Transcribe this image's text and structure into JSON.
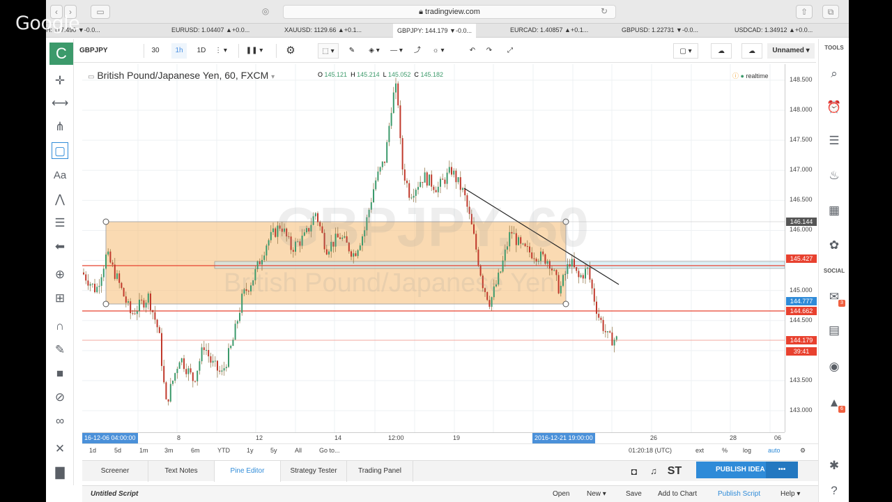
{
  "browser": {
    "url": "tradingview.com",
    "overlay_logo": "Google"
  },
  "ticker": [
    {
      "sym": "H: 117.490 ▼-0.0..."
    },
    {
      "sym": "EURUSD: 1.04407 ▲+0.0..."
    },
    {
      "sym": "XAUUSD: 1129.66 ▲+0.1..."
    },
    {
      "sym": "GBPJPY: 144.179 ▼-0.0..."
    },
    {
      "sym": "EURCAD: 1.40857 ▲+0.1..."
    },
    {
      "sym": "GBPUSD: 1.22731 ▼-0.0..."
    },
    {
      "sym": "USDCAD: 1.34912 ▲+0.0..."
    }
  ],
  "toolbar": {
    "symbol": "GBPJPY",
    "int_30": "30",
    "int_1h": "1h",
    "int_1d": "1D",
    "layout_name": "Unnamed"
  },
  "chart": {
    "title": "British Pound/Japanese Yen, 60, FXCM",
    "o_label": "O",
    "o": "145.121",
    "h_label": "H",
    "h": "145.214",
    "l_label": "L",
    "l": "145.052",
    "c_label": "C",
    "c": "145.182",
    "realtime": "realtime",
    "watermark_symbol": "GBPJPY, 60",
    "watermark_name": "British Pound/Japanese Yen"
  },
  "price_axis": {
    "labels": [
      "148.500",
      "148.000",
      "147.500",
      "147.000",
      "146.500",
      "146.000",
      "145.500",
      "145.000",
      "144.500",
      "143.500",
      "143.000"
    ],
    "tags": [
      {
        "text": "146.144",
        "color": "#555555"
      },
      {
        "text": "145.427",
        "color": "#e8412f"
      },
      {
        "text": "144.777",
        "color": "#2f8bd8"
      },
      {
        "text": "144.662",
        "color": "#e8412f"
      },
      {
        "text": "144.179",
        "color": "#e8412f"
      },
      {
        "text": "39:41",
        "color": "#e8412f"
      }
    ]
  },
  "time_axis": {
    "start_tag": "16-12-06 04:00:00",
    "cursor_tag": "2016-12-21 19:00:00",
    "labels": [
      "8",
      "12",
      "14",
      "12:00",
      "19",
      "26",
      "28",
      "06"
    ]
  },
  "range_bar": {
    "ranges": [
      "1d",
      "5d",
      "1m",
      "3m",
      "6m",
      "YTD",
      "1y",
      "5y",
      "All"
    ],
    "goto": "Go to...",
    "clock": "01:20:18 (UTC)",
    "ext": "ext",
    "pct": "%",
    "log": "log",
    "auto": "auto"
  },
  "bottom_tabs": [
    "Screener",
    "Text Notes",
    "Pine Editor",
    "Strategy Tester",
    "Trading Panel"
  ],
  "publish": {
    "label": "PUBLISH IDEA",
    "st": "ST"
  },
  "script_bar": {
    "name": "Untitled Script",
    "open": "Open",
    "new": "New",
    "save": "Save",
    "add": "Add to Chart",
    "publish": "Publish Script",
    "help": "Help"
  },
  "right_panel": {
    "tools_label": "TOOLS",
    "social_label": "SOCIAL",
    "badge_a": "3",
    "badge_b": "6"
  },
  "left_panel": {
    "logo": "C",
    "text_tool": "Aa"
  },
  "colors": {
    "accent": "#2f8bd8",
    "up": "#3c9a6b",
    "down": "#c0392b",
    "zone": "#f7c27e",
    "brand_green": "#3c9a6b"
  }
}
